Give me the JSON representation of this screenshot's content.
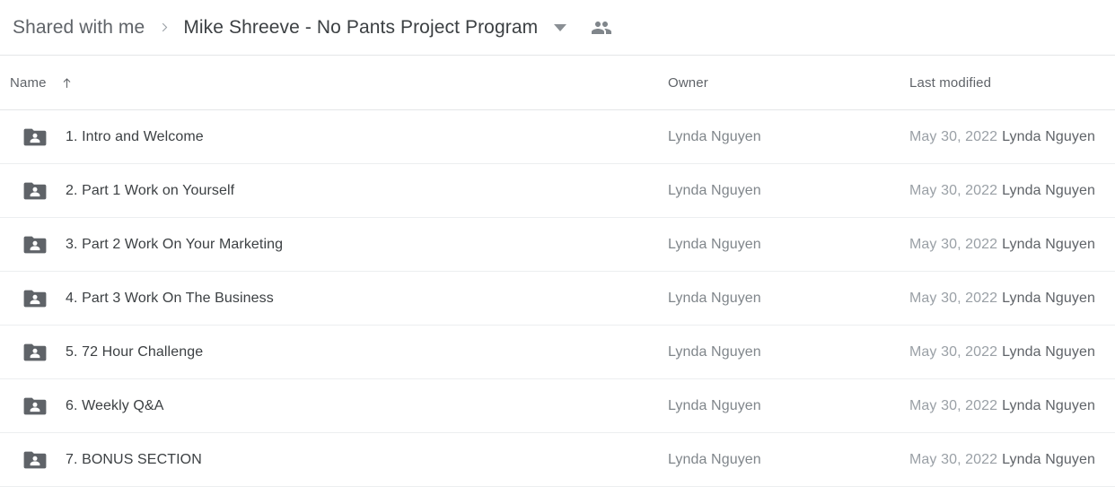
{
  "breadcrumb": {
    "parent_label": "Shared with me",
    "separator_icon": "chevron-right-icon",
    "current_label": "Mike Shreeve - No Pants Project Program",
    "caret_icon": "chevron-down-icon",
    "people_icon": "people-shared-icon"
  },
  "columns": {
    "name_label": "Name",
    "sort_icon": "arrow-up-icon",
    "owner_label": "Owner",
    "modified_label": "Last modified"
  },
  "colors": {
    "folder_icon": "#5f6368",
    "row_divider": "#eceef0",
    "primary_text": "#3c4043",
    "secondary_text": "#5f6368",
    "muted_text": "#9aa0a6"
  },
  "rows": [
    {
      "icon": "shared-folder-icon",
      "name": "1. Intro and Welcome",
      "owner": "Lynda Nguyen",
      "modified_date": "May 30, 2022",
      "modified_by": "Lynda Nguyen"
    },
    {
      "icon": "shared-folder-icon",
      "name": "2. Part 1 Work on Yourself",
      "owner": "Lynda Nguyen",
      "modified_date": "May 30, 2022",
      "modified_by": "Lynda Nguyen"
    },
    {
      "icon": "shared-folder-icon",
      "name": "3. Part 2 Work On Your Marketing",
      "owner": "Lynda Nguyen",
      "modified_date": "May 30, 2022",
      "modified_by": "Lynda Nguyen"
    },
    {
      "icon": "shared-folder-icon",
      "name": "4. Part 3 Work On The Business",
      "owner": "Lynda Nguyen",
      "modified_date": "May 30, 2022",
      "modified_by": "Lynda Nguyen"
    },
    {
      "icon": "shared-folder-icon",
      "name": "5. 72 Hour Challenge",
      "owner": "Lynda Nguyen",
      "modified_date": "May 30, 2022",
      "modified_by": "Lynda Nguyen"
    },
    {
      "icon": "shared-folder-icon",
      "name": "6. Weekly Q&A",
      "owner": "Lynda Nguyen",
      "modified_date": "May 30, 2022",
      "modified_by": "Lynda Nguyen"
    },
    {
      "icon": "shared-folder-icon",
      "name": "7. BONUS SECTION",
      "owner": "Lynda Nguyen",
      "modified_date": "May 30, 2022",
      "modified_by": "Lynda Nguyen"
    }
  ]
}
